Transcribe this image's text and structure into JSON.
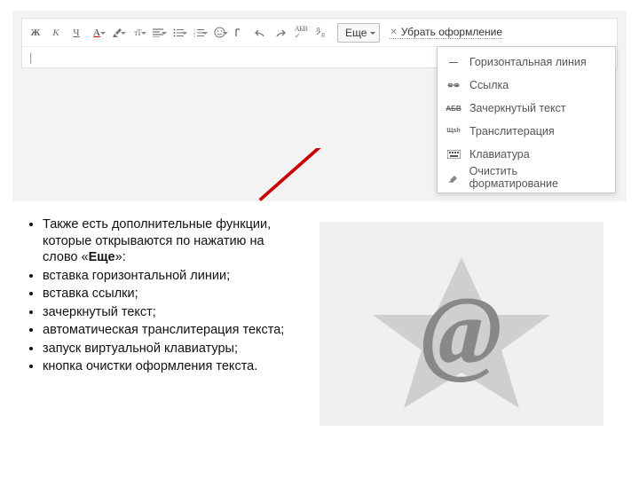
{
  "toolbar": {
    "bold": "Ж",
    "italic": "К",
    "underline": "Ч",
    "color": "А",
    "size": "тТ",
    "strike": "АБВ",
    "translit_small": "Ц",
    "more_label": "Еще",
    "clear_label": "Убрать оформление"
  },
  "menu": {
    "items": [
      {
        "label": "Горизонтальная линия"
      },
      {
        "label": "Ссылка"
      },
      {
        "label": "Зачеркнутый текст"
      },
      {
        "label": "Транслитерация"
      },
      {
        "label": "Клавиатура"
      },
      {
        "label": "Очистить форматирование"
      }
    ],
    "icon_strike": "АБВ",
    "icon_translit": "Щsh"
  },
  "bullets": {
    "items": [
      "Также есть дополнительные функции, которые открываются по нажатию на слово «|BOLD|»:",
      "вставка горизонтальной линии;",
      "вставка ссылки;",
      "зачеркнутый текст;",
      "автоматическая транслитерация текста;",
      "запуск виртуальной клавиатуры;",
      "кнопка очистки оформления текста."
    ],
    "bold_word": "Еще"
  }
}
